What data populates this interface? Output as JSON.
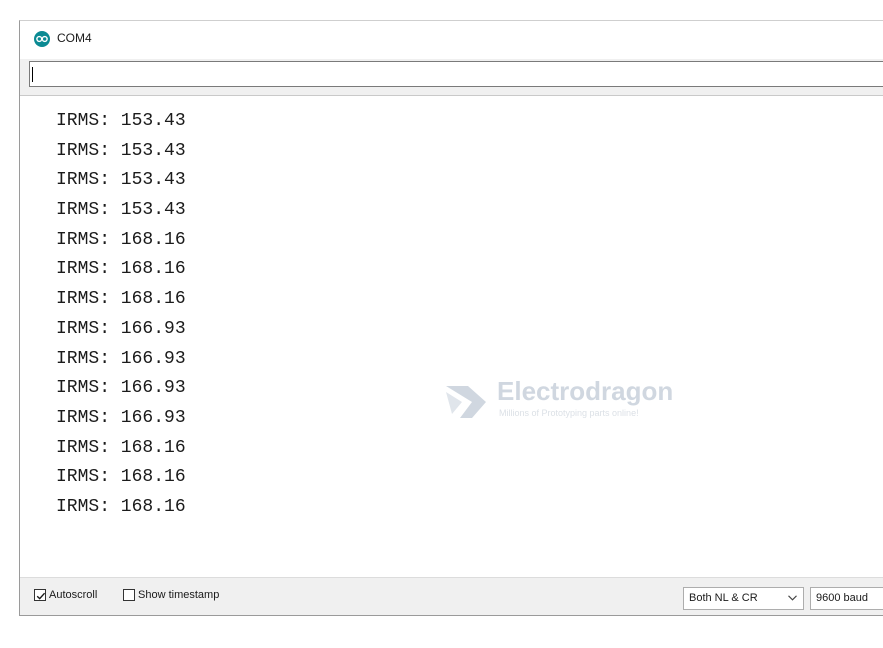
{
  "window": {
    "title": "COM4"
  },
  "send": {
    "value": ""
  },
  "output": {
    "lines": [
      "IRMS: 153.43",
      "IRMS: 153.43",
      "IRMS: 153.43",
      "IRMS: 153.43",
      "IRMS: 168.16",
      "IRMS: 168.16",
      "IRMS: 168.16",
      "IRMS: 166.93",
      "IRMS: 166.93",
      "IRMS: 166.93",
      "IRMS: 166.93",
      "IRMS: 168.16",
      "IRMS: 168.16",
      "IRMS: 168.16"
    ]
  },
  "watermark": {
    "name": "Electrodragon",
    "tagline": "Millions of Prototyping parts online!"
  },
  "statusbar": {
    "autoscroll_label": "Autoscroll",
    "autoscroll_checked": true,
    "timestamp_label": "Show timestamp",
    "timestamp_checked": false,
    "line_ending": "Both NL & CR",
    "baud": "9600 baud"
  },
  "icons": {
    "app": "arduino-icon",
    "check": "checkmark-icon",
    "dropdown": "chevron-down-icon"
  },
  "colors": {
    "arduino_teal": "#0b8a93",
    "panel_gray": "#f0f0f0"
  }
}
